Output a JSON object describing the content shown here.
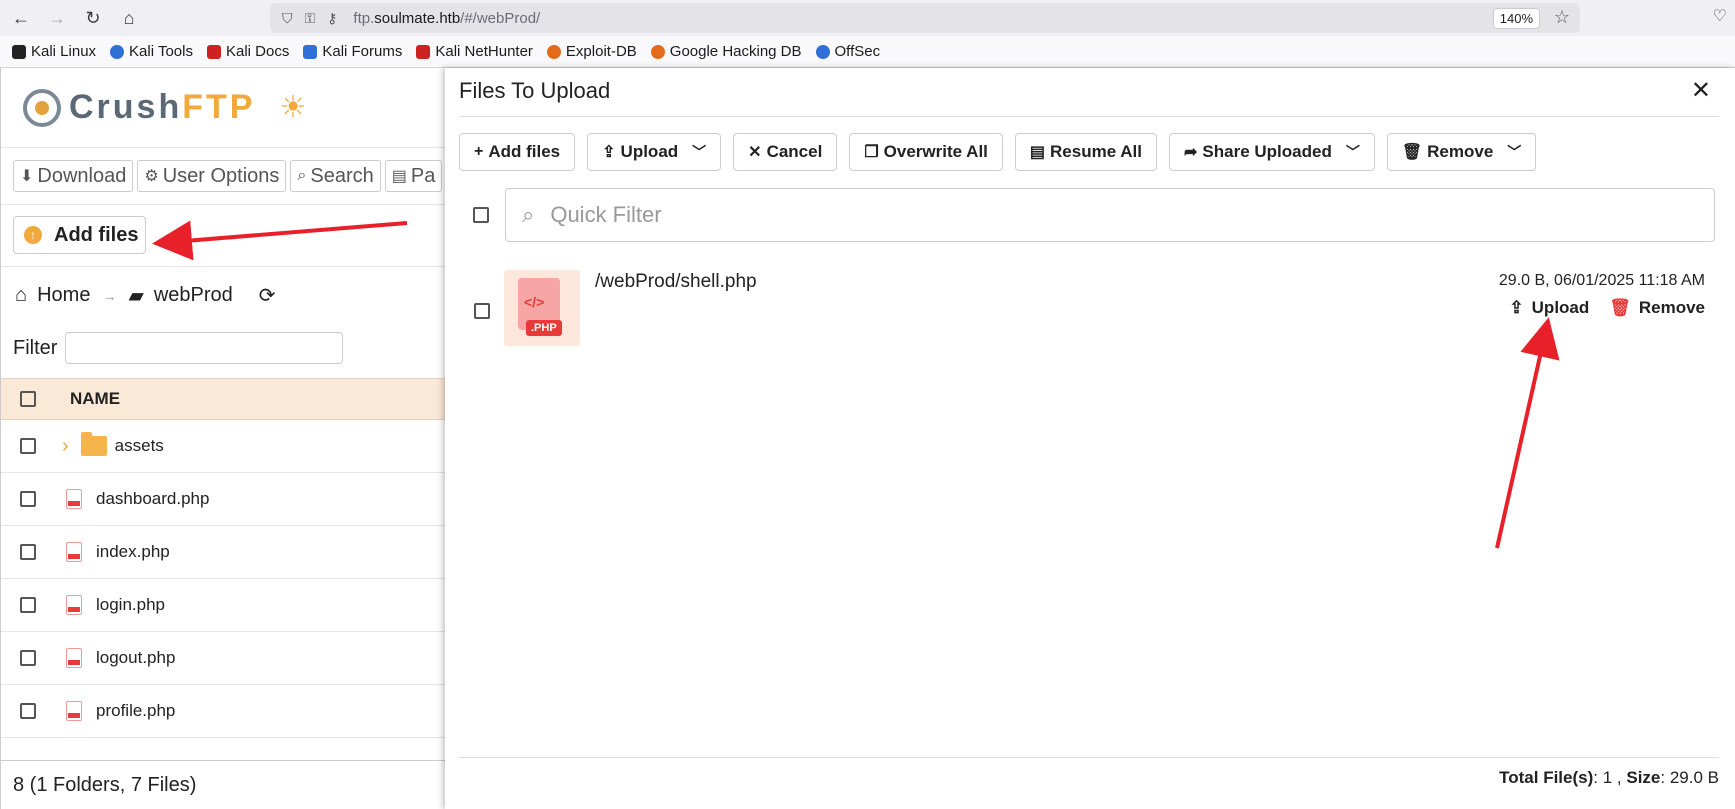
{
  "browser": {
    "url_prefix": "ftp.",
    "url_host": "soulmate.htb",
    "url_path": "/#/webProd/",
    "zoom": "140%"
  },
  "bookmarks": [
    {
      "label": "Kali Linux",
      "color": "#222222"
    },
    {
      "label": "Kali Tools",
      "color": "#2f6fd6"
    },
    {
      "label": "Kali Docs",
      "color": "#cc2222"
    },
    {
      "label": "Kali Forums",
      "color": "#2f6fd6"
    },
    {
      "label": "Kali NetHunter",
      "color": "#cc2222"
    },
    {
      "label": "Exploit-DB",
      "color": "#e36b1e"
    },
    {
      "label": "Google Hacking DB",
      "color": "#e36b1e"
    },
    {
      "label": "OffSec",
      "color": "#2f6fd6"
    }
  ],
  "app": {
    "logo_main": "Crush",
    "logo_accent": "FTP",
    "actions": [
      {
        "label": "Download",
        "icon": "⬇"
      },
      {
        "label": "User Options",
        "icon": "⚙"
      },
      {
        "label": "Search",
        "icon": "⌕"
      },
      {
        "label": "Pa",
        "icon": "▤"
      }
    ],
    "add_files": "Add files",
    "breadcrumb": {
      "home": "Home",
      "folder": "webProd"
    },
    "filter_label": "Filter",
    "column_name": "NAME",
    "rows": [
      {
        "name": "assets",
        "type": "folder"
      },
      {
        "name": "dashboard.php",
        "type": "file"
      },
      {
        "name": "index.php",
        "type": "file"
      },
      {
        "name": "login.php",
        "type": "file"
      },
      {
        "name": "logout.php",
        "type": "file"
      },
      {
        "name": "profile.php",
        "type": "file"
      }
    ],
    "status": "8 (1 Folders, 7 Files)"
  },
  "modal": {
    "title": "Files To Upload",
    "toolbar": {
      "add_files": "Add files",
      "upload": "Upload",
      "cancel": "Cancel",
      "overwrite_all": "Overwrite All",
      "resume_all": "Resume All",
      "share_uploaded": "Share Uploaded",
      "remove": "Remove"
    },
    "quick_filter_placeholder": "Quick Filter",
    "file": {
      "path": "/webProd/shell.php",
      "meta": "29.0 B, 06/01/2025 11:18 AM",
      "badge": ".PHP",
      "upload_label": "Upload",
      "remove_label": "Remove"
    },
    "footer": {
      "total_label": "Total File(s)",
      "total_value": ": 1 ,",
      "size_label": "Size",
      "size_value": ": 29.0 B"
    }
  }
}
